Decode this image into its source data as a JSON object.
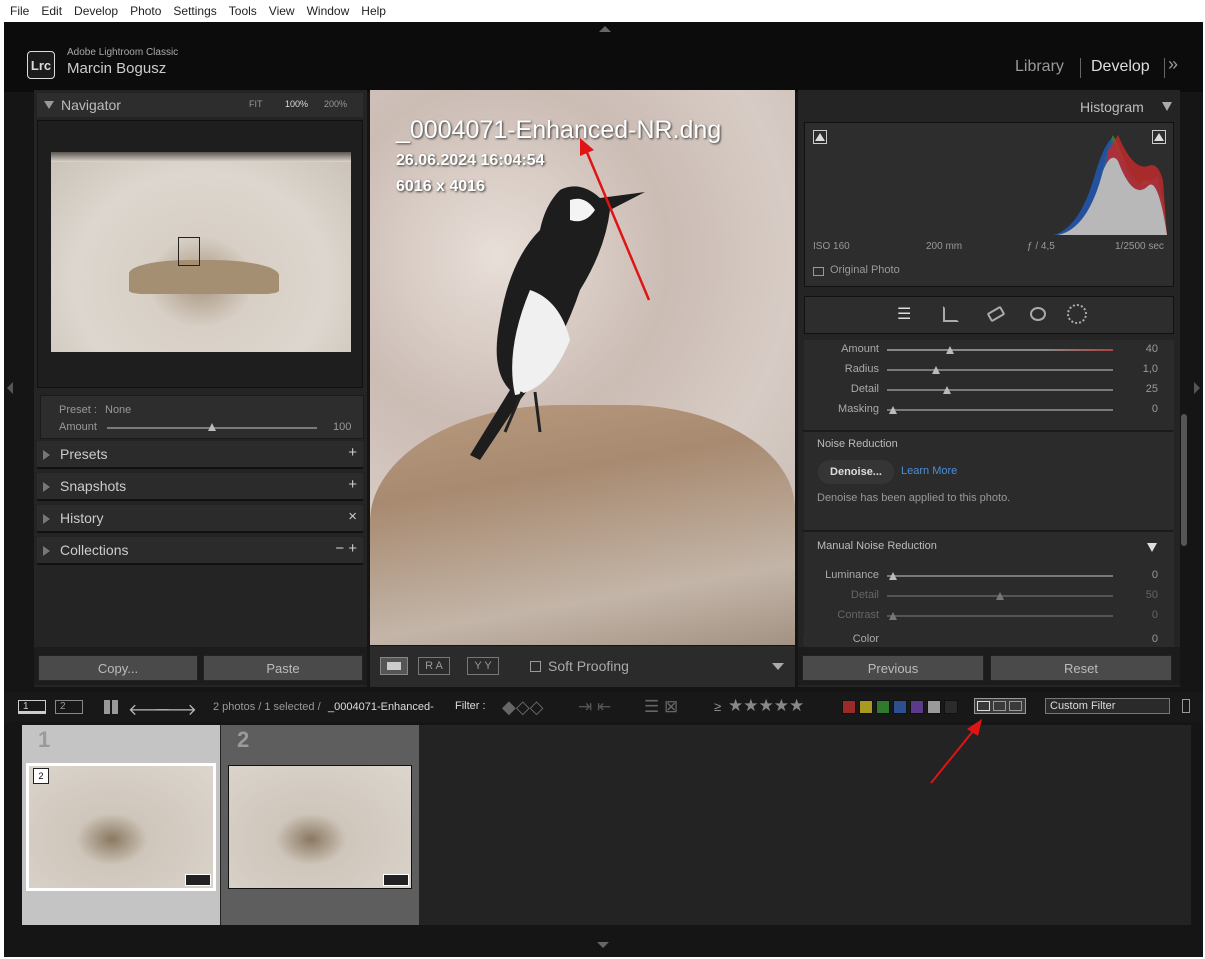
{
  "menu": [
    "File",
    "Edit",
    "Develop",
    "Photo",
    "Settings",
    "Tools",
    "View",
    "Window",
    "Help"
  ],
  "app": {
    "name": "Adobe Lightroom Classic",
    "user": "Marcin Bogusz",
    "logo": "Lrc"
  },
  "modules": {
    "library": "Library",
    "develop": "Develop",
    "more": "»"
  },
  "navigator": {
    "title": "Navigator",
    "fit": "FIT",
    "zoom100": "100%",
    "zoom200": "200%"
  },
  "preset": {
    "label": "Preset :",
    "value": "None",
    "amount_label": "Amount",
    "amount_value": "100"
  },
  "left_sections": [
    {
      "label": "Presets",
      "action": "+"
    },
    {
      "label": "Snapshots",
      "action": "+"
    },
    {
      "label": "History",
      "action": "×"
    },
    {
      "label": "Collections",
      "action": "− +"
    }
  ],
  "left_buttons": {
    "copy": "Copy...",
    "paste": "Paste"
  },
  "photo": {
    "filename": "_0004071-Enhanced-NR.dng",
    "date": "26.06.2024 16:04:54",
    "dims": "6016 x 4016"
  },
  "toolbar": {
    "ra": "R A",
    "yy": "Y Y",
    "soft_proofing": "Soft Proofing"
  },
  "histogram": {
    "title": "Histogram",
    "iso": "ISO 160",
    "focal": "200 mm",
    "aperture": "ƒ / 4,5",
    "shutter": "1/2500 sec",
    "original_photo": "Original Photo"
  },
  "sharpen": [
    {
      "label": "Amount",
      "value": "40",
      "pos": 0.28
    },
    {
      "label": "Radius",
      "value": "1,0",
      "pos": 0.22
    },
    {
      "label": "Detail",
      "value": "25",
      "pos": 0.27
    },
    {
      "label": "Masking",
      "value": "0",
      "pos": 0.02
    }
  ],
  "noise": {
    "title": "Noise Reduction",
    "denoise": "Denoise...",
    "learn_more": "Learn More",
    "status": "Denoise has been applied to this photo.",
    "manual": "Manual Noise Reduction"
  },
  "manual_nr": [
    {
      "label": "Luminance",
      "value": "0",
      "pos": 0.02
    },
    {
      "label": "Detail",
      "value": "50",
      "pos": 0.5
    },
    {
      "label": "Contrast",
      "value": "0",
      "pos": 0.02
    },
    {
      "label": "Color",
      "value": "0",
      "pos": 0.02
    }
  ],
  "right_buttons": {
    "previous": "Previous",
    "reset": "Reset"
  },
  "filmstrip_bar": {
    "screen1": "1",
    "screen2": "2",
    "status_prefix": "2 photos / 1 selected /",
    "status_file": "_0004071-Enhanced-",
    "filter_label": "Filter :",
    "gte": "≥",
    "custom_filter": "Custom Filter"
  },
  "filmstrip": [
    {
      "index": "1",
      "badge": "2"
    },
    {
      "index": "2",
      "badge": ""
    }
  ],
  "colors": {
    "red": "#9b2a2a",
    "yellow": "#a89a1f",
    "green": "#2f7a2f",
    "blue": "#2e4f8f",
    "purple": "#5b3a8a",
    "gray": "#9a9a9a",
    "black": "#2b2b2b",
    "annotation": "#e01414"
  }
}
